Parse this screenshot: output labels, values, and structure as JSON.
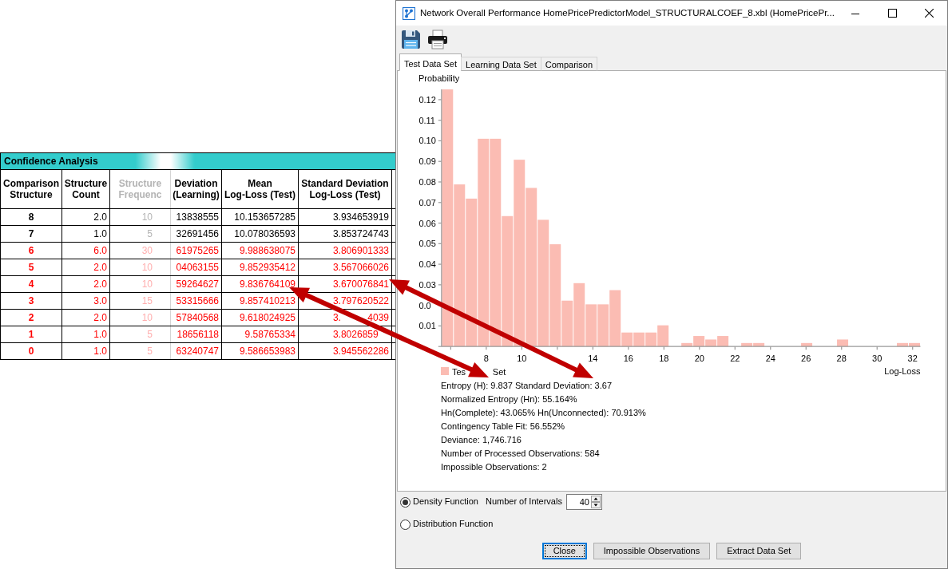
{
  "confidence_table": {
    "title": "Confidence Analysis",
    "columns": [
      {
        "label": "Comparison\nStructure",
        "faded": false
      },
      {
        "label": "Structure\nCount",
        "faded": false
      },
      {
        "label": "Structure\nFrequenc",
        "faded": true
      },
      {
        "label": "Deviation\n(Learning)",
        "faded": false
      },
      {
        "label": "Mean\nLog-Loss (Test)",
        "faded": false
      },
      {
        "label": "Standard Deviation\nLog-Loss (Test)",
        "faded": false
      }
    ],
    "rows": [
      {
        "flagged": false,
        "cells": [
          "8",
          "2.0",
          "10",
          "13838555",
          "10.153657285",
          "3.934653919"
        ]
      },
      {
        "flagged": false,
        "cells": [
          "7",
          "1.0",
          "5",
          "32691456",
          "10.078036593",
          "3.853724743"
        ]
      },
      {
        "flagged": true,
        "cells": [
          "6",
          "6.0",
          "30",
          "61975265",
          "9.988638075",
          "3.806901333"
        ]
      },
      {
        "flagged": true,
        "cells": [
          "5",
          "2.0",
          "10",
          "04063155",
          "9.852935412",
          "3.567066026"
        ]
      },
      {
        "flagged": true,
        "cells": [
          "4",
          "2.0",
          "10",
          "59264627",
          "9.836764109",
          "3.670076841"
        ]
      },
      {
        "flagged": true,
        "cells": [
          "3",
          "3.0",
          "15",
          "53315666",
          "9.857410213",
          "3.797620522"
        ]
      },
      {
        "flagged": true,
        "cells": [
          "2",
          "2.0",
          "10",
          "57840568",
          "9.618024925",
          [
            "3.",
            "4039"
          ]
        ]
      },
      {
        "flagged": true,
        "cells": [
          "1",
          "1.0",
          "5",
          "18656118",
          "9.58765334",
          [
            "3.8026859"
          ]
        ]
      },
      {
        "flagged": true,
        "cells": [
          "0",
          "1.0",
          "5",
          "63240747",
          "9.586653983",
          "3.945562286"
        ]
      }
    ]
  },
  "window": {
    "title": "Network Overall Performance HomePricePredictorModel_STRUCTURALCOEF_8.xbl (HomePricePr..."
  },
  "tabs": [
    {
      "label": "Test Data Set",
      "selected": true
    },
    {
      "label": "Learning Data Set",
      "selected": false
    },
    {
      "label": "Comparison",
      "selected": false
    }
  ],
  "chart_panel": {
    "chart_data": {
      "type": "bar",
      "ylabel": "Probability",
      "xlabel": "Log-Loss",
      "x": [
        5.817,
        6.491,
        7.165,
        7.839,
        8.513,
        9.187,
        9.861,
        10.535,
        11.209,
        11.883,
        12.557,
        13.231,
        13.905,
        14.579,
        15.253,
        15.927,
        16.601,
        17.275,
        17.949,
        19.297,
        19.971,
        20.645,
        21.319,
        22.667,
        23.341,
        26.037,
        28.059,
        31.429,
        32.103
      ],
      "series": [
        {
          "color": "#fbbcb3",
          "values": [
            0.125,
            0.0788,
            0.0719,
            0.101,
            0.101,
            0.0634,
            0.0908,
            0.0771,
            0.0616,
            0.0497,
            0.0223,
            0.0308,
            0.0205,
            0.0205,
            0.0274,
            0.0068,
            0.0068,
            0.0068,
            0.0103,
            0.0017,
            0.0051,
            0.0034,
            0.0051,
            0.0017,
            0.0017,
            0.0017,
            0.0034,
            0.0017,
            0.0017
          ]
        }
      ],
      "xlim": [
        5.48,
        32.44
      ],
      "ylim": [
        0,
        0.125
      ],
      "xticks": [
        8,
        10,
        14,
        16,
        18,
        20,
        22,
        24,
        26,
        28,
        30,
        32
      ],
      "yticks": [
        {
          "value": 0.01,
          "label": "0.01"
        },
        {
          "value": 0.02,
          "label": "0.0"
        },
        {
          "value": 0.03,
          "label": "0.03"
        },
        {
          "value": 0.04,
          "label": "0.04"
        },
        {
          "value": 0.05,
          "label": "0.05"
        },
        {
          "value": 0.06,
          "label": "0.06"
        },
        {
          "value": 0.07,
          "label": "0.07"
        },
        {
          "value": 0.08,
          "label": "0.08"
        },
        {
          "value": 0.09,
          "label": "0.09"
        },
        {
          "value": 0.1,
          "label": "0.10"
        },
        {
          "value": 0.11,
          "label": "0.11"
        },
        {
          "value": 0.12,
          "label": "0.12"
        }
      ]
    },
    "legend": [
      "Tes",
      "Set"
    ],
    "stats": [
      "Entropy (H): 9.837 Standard Deviation: 3.67",
      "Normalized Entropy (Hn): 55.164%",
      "Hn(Complete): 43.065% Hn(Unconnected): 70.913%",
      "Contingency Table Fit: 56.552%",
      "Deviance: 1,746.716",
      "Number of Processed Observations: 584",
      "Impossible Observations: 2"
    ]
  },
  "function_options": [
    {
      "label": "Density Function",
      "selected": true
    },
    {
      "label": "Distribution Function",
      "selected": false
    }
  ],
  "intervals": {
    "label": "Number of Intervals",
    "value": "40"
  },
  "buttons": [
    {
      "label": "Close",
      "focused": true
    },
    {
      "label": "Impossible Observations",
      "focused": false
    },
    {
      "label": "Extract Data Set",
      "focused": false
    }
  ]
}
